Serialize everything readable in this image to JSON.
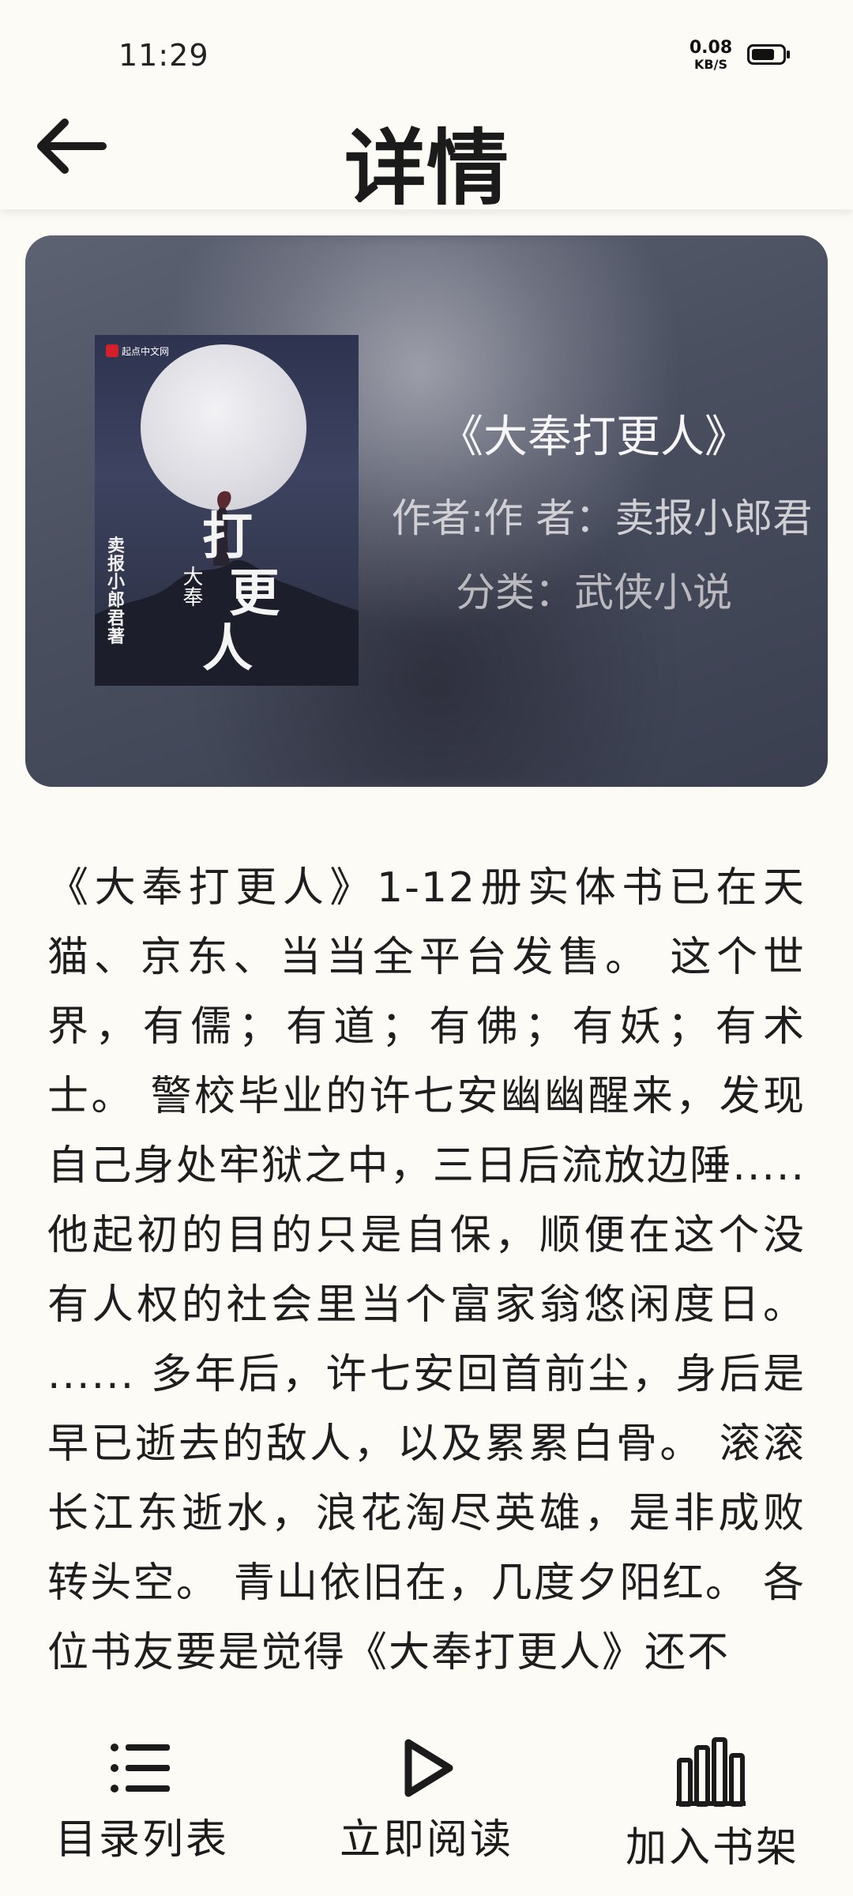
{
  "status_bar": {
    "time": "11:29",
    "net_speed_value": "0.08",
    "net_speed_unit": "KB/S",
    "battery_icon": "battery-icon"
  },
  "header": {
    "back_icon": "arrow-left-icon",
    "title": "详情"
  },
  "book": {
    "cover_publisher": "起点中文网",
    "cover_title_chars": [
      "打",
      "更",
      "人"
    ],
    "cover_series_char": "大奉",
    "cover_author": "卖报小郎君著",
    "title": "《大奉打更人》",
    "author": "作者:作  者：卖报小郎君",
    "category": "分类：武侠小说"
  },
  "description": "《大奉打更人》1-12册实体书已在天猫、京东、当当全平台发售。 这个世界，有儒；有道；有佛；有妖；有术士。 警校毕业的许七安幽幽醒来，发现自己身处牢狱之中，三日后流放边陲..... 他起初的目的只是自保，顺便在这个没有人权的社会里当个富家翁悠闲度日。 ...... 多年后，许七安回首前尘，身后是早已逝去的敌人，以及累累白骨。 滚滚长江东逝水，浪花淘尽英雄，是非成败转头空。 青山依旧在，几度夕阳红。 各位书友要是觉得《大奉打更人》还不",
  "bottom_bar": {
    "catalog": {
      "label": "目录列表",
      "icon": "list-icon"
    },
    "read": {
      "label": "立即阅读",
      "icon": "play-icon"
    },
    "shelf": {
      "label": "加入书架",
      "icon": "bookshelf-icon"
    }
  },
  "colors": {
    "background": "#fcfbf6",
    "card": "#4a4f60",
    "text": "#1b1b1b"
  }
}
